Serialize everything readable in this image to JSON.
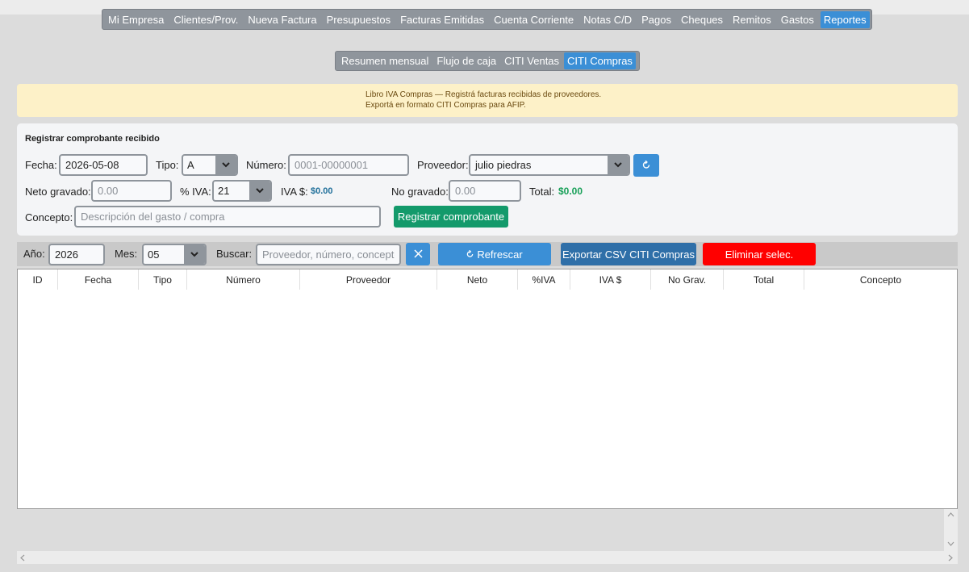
{
  "main_nav": [
    "Mi Empresa",
    "Clientes/Prov.",
    "Nueva Factura",
    "Presupuestos",
    "Facturas Emitidas",
    "Cuenta Corriente",
    "Notas C/D",
    "Pagos",
    "Cheques",
    "Remitos",
    "Gastos",
    "Reportes"
  ],
  "main_nav_active": "Reportes",
  "sub_nav": [
    "Resumen mensual",
    "Flujo de caja",
    "CITI Ventas",
    "CITI Compras"
  ],
  "sub_nav_active": "CITI Compras",
  "notice": {
    "line1": "Libro IVA Compras — Registrá facturas recibidas de proveedores.",
    "line2": "Exportá en formato CITI Compras para AFIP."
  },
  "form": {
    "title": "Registrar comprobante recibido",
    "fecha_label": "Fecha:",
    "fecha_value": "2026-05-08",
    "tipo_label": "Tipo:",
    "tipo_value": "A",
    "numero_label": "Número:",
    "numero_placeholder": "0001-00000001",
    "proveedor_label": "Proveedor:",
    "proveedor_value": "julio piedras",
    "refresh_icon": "refresh-icon",
    "neto_label": "Neto gravado:",
    "neto_placeholder": "0.00",
    "iva_pct_label": "% IVA:",
    "iva_pct_value": "21",
    "iva_amount_label": "IVA $:",
    "iva_amount_value": "$0.00",
    "no_gravado_label": "No gravado:",
    "no_gravado_placeholder": "0.00",
    "total_label": "Total:",
    "total_value": "$0.00",
    "concepto_label": "Concepto:",
    "concepto_placeholder": "Descripción del gasto / compra",
    "submit_label": "Registrar comprobante"
  },
  "filters": {
    "anio_label": "Año:",
    "anio_value": "2026",
    "mes_label": "Mes:",
    "mes_value": "05",
    "buscar_label": "Buscar:",
    "buscar_placeholder": "Proveedor, número, concepto...",
    "refrescar_label": "Refrescar",
    "exportar_label": "Exportar CSV CITI Compras",
    "eliminar_label": "Eliminar selec."
  },
  "table": {
    "columns": [
      "ID",
      "Fecha",
      "Tipo",
      "Número",
      "Proveedor",
      "Neto",
      "%IVA",
      "IVA $",
      "No Grav.",
      "Total",
      "Concepto"
    ],
    "rows": []
  },
  "colors": {
    "accent": "#3b8fd6",
    "success": "#139a6b",
    "export": "#2f6fa8",
    "danger": "#ff0000",
    "nav_bg": "#8f959c",
    "notice_bg": "#fdf1c8"
  }
}
